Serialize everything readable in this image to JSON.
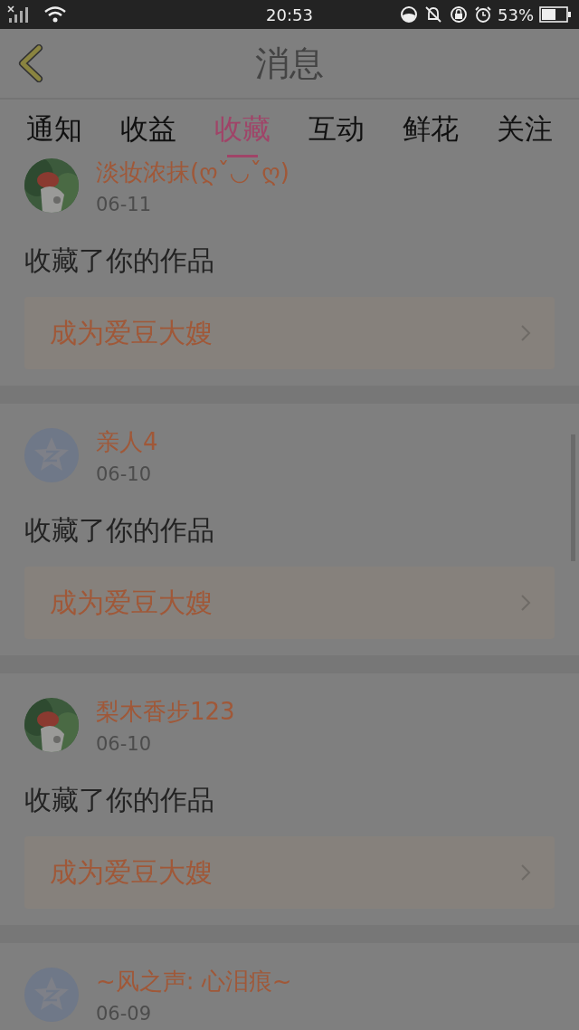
{
  "status_bar": {
    "time": "20:53",
    "battery_text": "53%"
  },
  "header": {
    "title": "消息"
  },
  "tabs": [
    {
      "label": "通知",
      "selected": false
    },
    {
      "label": "收益",
      "selected": false
    },
    {
      "label": "收藏",
      "selected": true
    },
    {
      "label": "互动",
      "selected": false
    },
    {
      "label": "鲜花",
      "selected": false
    },
    {
      "label": "关注",
      "selected": false
    }
  ],
  "messages": [
    {
      "name": "淡妆浓抹(ღˇ◡ˇღ)",
      "date": "06-11",
      "text": "收藏了你的作品",
      "action": "成为爱豆大嫂"
    },
    {
      "avatar": {
        "kind": "default"
      },
      "name": "亲人4",
      "date": "06-10",
      "text": "收藏了你的作品",
      "action": "成为爱豆大嫂"
    },
    {
      "name": "梨木香步123",
      "date": "06-10",
      "text": "收藏了你的作品",
      "action": "成为爱豆大嫂"
    },
    {
      "avatar": {
        "kind": "default"
      },
      "name": "~风之声: 心泪痕~",
      "date": "06-09"
    }
  ]
}
